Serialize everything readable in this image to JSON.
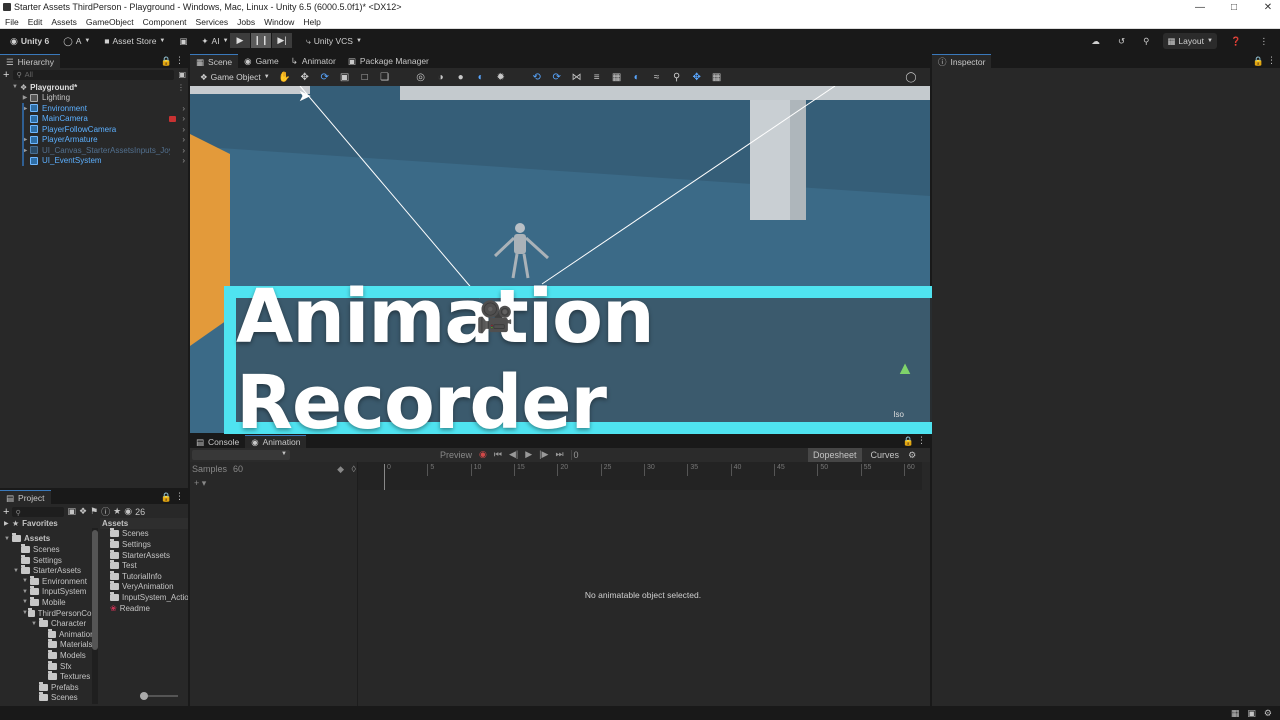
{
  "window": {
    "title": "Starter Assets ThirdPerson - Playground - Windows, Mac, Linux - Unity 6.5 (6000.5.0f1)* <DX12>",
    "controls": [
      "minimize",
      "maximize",
      "close"
    ]
  },
  "menu": [
    "File",
    "Edit",
    "Assets",
    "GameObject",
    "Component",
    "Services",
    "Jobs",
    "Window",
    "Help"
  ],
  "toolbar": {
    "unity_label": "Unity 6",
    "account_label": "A",
    "asset_store_label": "Asset Store",
    "ai_label": "AI",
    "vcs_label": "Unity VCS",
    "layout_label": "Layout"
  },
  "hierarchy": {
    "tab_label": "Hierarchy",
    "search_placeholder": "All",
    "items": [
      {
        "label": "Playground*",
        "depth": 0,
        "style": "scene"
      },
      {
        "label": "Lighting",
        "depth": 1,
        "style": "normal"
      },
      {
        "label": "Environment",
        "depth": 1,
        "style": "prefab"
      },
      {
        "label": "MainCamera",
        "depth": 1,
        "style": "prefab"
      },
      {
        "label": "PlayerFollowCamera",
        "depth": 1,
        "style": "prefab"
      },
      {
        "label": "PlayerArmature",
        "depth": 1,
        "style": "prefab"
      },
      {
        "label": "UI_Canvas_StarterAssetsInputs_Joysticks",
        "depth": 1,
        "style": "disabled"
      },
      {
        "label": "UI_EventSystem",
        "depth": 1,
        "style": "prefab"
      }
    ]
  },
  "scene_tabs": [
    {
      "label": "Scene",
      "active": true
    },
    {
      "label": "Game",
      "active": false
    },
    {
      "label": "Animator",
      "active": false
    },
    {
      "label": "Package Manager",
      "active": false
    }
  ],
  "scene_toolbar": {
    "mode_label": "Game Object",
    "iso_label": "Iso"
  },
  "overlay": {
    "title": "Animation Recorder"
  },
  "bottom_tabs": [
    {
      "label": "Console",
      "active": false
    },
    {
      "label": "Animation",
      "active": true
    }
  ],
  "animation": {
    "preview_label": "Preview",
    "frame_value": "0",
    "samples_label": "Samples",
    "samples_value": "60",
    "dopesheet_label": "Dopesheet",
    "curves_label": "Curves",
    "ticks": [
      "0",
      "5",
      "10",
      "15",
      "20",
      "25",
      "30",
      "35",
      "40",
      "45",
      "50",
      "55",
      "60"
    ],
    "message": "No animatable object selected."
  },
  "project": {
    "tab_label": "Project",
    "hidden_count": "26",
    "favorites_label": "Favorites",
    "tree": [
      {
        "label": "Assets",
        "depth": 0,
        "bold": true
      },
      {
        "label": "Scenes",
        "depth": 1
      },
      {
        "label": "Settings",
        "depth": 1
      },
      {
        "label": "StarterAssets",
        "depth": 1
      },
      {
        "label": "Environment",
        "depth": 2
      },
      {
        "label": "InputSystem",
        "depth": 2
      },
      {
        "label": "Mobile",
        "depth": 2
      },
      {
        "label": "ThirdPersonController",
        "depth": 2
      },
      {
        "label": "Character",
        "depth": 3
      },
      {
        "label": "Animations",
        "depth": 4
      },
      {
        "label": "Materials",
        "depth": 4
      },
      {
        "label": "Models",
        "depth": 4
      },
      {
        "label": "Sfx",
        "depth": 4
      },
      {
        "label": "Textures",
        "depth": 4
      },
      {
        "label": "Prefabs",
        "depth": 3
      },
      {
        "label": "Scenes",
        "depth": 3
      }
    ],
    "assets_header": "Assets",
    "assets": [
      "Scenes",
      "Settings",
      "StarterAssets",
      "Test",
      "TutorialInfo",
      "VeryAnimation",
      "InputSystem_Actions",
      "Readme"
    ]
  },
  "inspector": {
    "tab_label": "Inspector"
  },
  "colors": {
    "accent": "#3a79bb",
    "banner_border": "#4fe3f0",
    "prefab_blue": "#5cb0ff"
  }
}
